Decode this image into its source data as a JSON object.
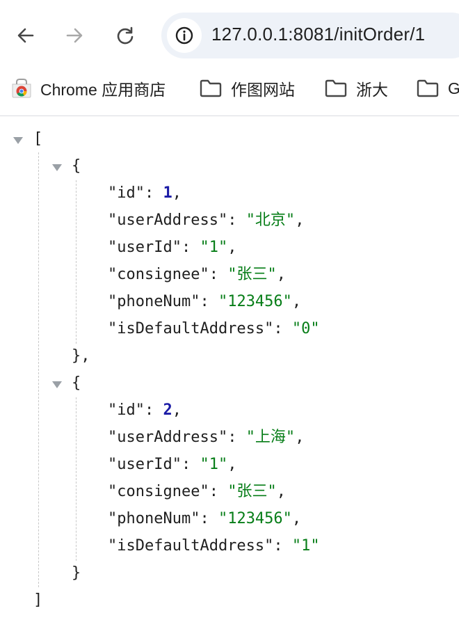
{
  "browser": {
    "url": "127.0.0.1:8081/initOrder/1",
    "icons": {
      "back": "arrow-left-icon",
      "forward": "arrow-right-icon",
      "reload": "reload-icon",
      "site_info": "info-circle-icon"
    },
    "bookmarks": [
      {
        "label": "Chrome 应用商店",
        "icon": "chrome-webstore-icon"
      },
      {
        "label": "作图网站",
        "icon": "folder-icon"
      },
      {
        "label": "浙大",
        "icon": "folder-icon"
      },
      {
        "label": "G",
        "icon": "folder-icon"
      }
    ]
  },
  "json_viewer": {
    "open_bracket": "[",
    "close_bracket": "]",
    "open_brace": "{",
    "close_brace_comma": "},",
    "close_brace": "}",
    "items": [
      {
        "id": "1",
        "userAddress": "\"北京\"",
        "userId": "\"1\"",
        "consignee": "\"张三\"",
        "phoneNum": "\"123456\"",
        "isDefaultAddress": "\"0\""
      },
      {
        "id": "2",
        "userAddress": "\"上海\"",
        "userId": "\"1\"",
        "consignee": "\"张三\"",
        "phoneNum": "\"123456\"",
        "isDefaultAddress": "\"1\""
      }
    ],
    "keys": {
      "id": "\"id\"",
      "userAddress": "\"userAddress\"",
      "userId": "\"userId\"",
      "consignee": "\"consignee\"",
      "phoneNum": "\"phoneNum\"",
      "isDefaultAddress": "\"isDefaultAddress\""
    },
    "colors": {
      "number": "#1a1aa6",
      "string": "#067d17",
      "key": "#1f1f1f"
    }
  }
}
